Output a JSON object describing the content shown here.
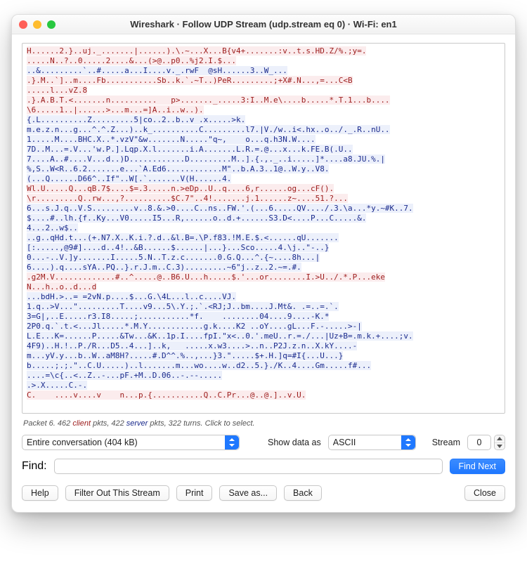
{
  "window": {
    "title": "Wireshark · Follow UDP Stream (udp.stream eq 0) · Wi-Fi: en1"
  },
  "stream": {
    "lines": [
      {
        "cls": "c",
        "t": "H......2.}..uj._.......|......).\\.~...X...B{v4+.......:v..t.s.HD.Z/%.;y=."
      },
      {
        "cls": "c",
        "t": ".....N..?..0.....2....&...(>@..p0..%j2.I.$..."
      },
      {
        "cls": "s",
        "t": "..&.........`..#.....a...I....v._.rwF  @sH......3..W_..."
      },
      {
        "cls": "c",
        "t": ".}.M..`]..m....Fb...........Sb..k.`.~T..)PeR.........;+X#.N...,=...C<B"
      },
      {
        "cls": "c",
        "t": ".....l...vZ.8"
      },
      {
        "cls": "c",
        "t": ".}.A.B.T.<.......n..........   p>......._.....3:I..M.e\\....b.....*.T.1...b...."
      },
      {
        "cls": "c",
        "t": "\\6.....1..|......>...m...=]A..i..w..)."
      },
      {
        "cls": "s",
        "t": "{.L..........Z.........5|co..2..b..v .x.....>k."
      },
      {
        "cls": "s",
        "t": "m.e.z.n...g...^.^.Z...)..k_..........C.........l7.|V./w..i<.hx..o../._.R..nU.."
      },
      {
        "cls": "s",
        "t": "1.....M....BHC.X..*.vzV\"&w.......N.....\"q~,    o...q.h3N.W...."
      },
      {
        "cls": "s",
        "t": "7D..M...=.V...'w.P.].Lqp.X.l.......i.A.......L.R.=.@...x...k.FE.B(.U.."
      },
      {
        "cls": "s",
        "t": "7....A..#....V...d..)D............D.........M..].{.,._..i.....]*....a8.JU.%.|"
      },
      {
        "cls": "s",
        "t": "%,S..W<R..6.2.......e...`A.Ed6............M\"..b.A.3..1@..W.y..V8."
      },
      {
        "cls": "s",
        "t": "(...Q......D66^..If\"..W[.`.......V(H......4."
      },
      {
        "cls": "c",
        "t": "Wl.U.....Q...qB.7$....$=.3.....n.>eDp..U..q....6,r......og...cF()."
      },
      {
        "cls": "c",
        "t": "\\r.........Q..rw...,?..........$C.7\"..4!.......j.1......z~....51.?..."
      },
      {
        "cls": "s",
        "t": "6...s.J.q..V.S.........v..8.&.>0....C..ns..FW.'.(...6.....QV..../.3.\\a...*y.~#K..7."
      },
      {
        "cls": "s",
        "t": "$....#..lh.{f..Ky...V0.....I5...R,......o..d.+......S3.D<....P...C.....&."
      },
      {
        "cls": "s",
        "t": "4...2..w$.."
      },
      {
        "cls": "s",
        "t": "..g..qHd.t...(+.N7.X..K.i.?.d..&l.B=.\\P.f83.!M.E.$.<......qU......."
      },
      {
        "cls": "s",
        "t": "[:.....,@9#]....d..4!..&B......$......|...}...Sco.....4.\\j..\"-..}"
      },
      {
        "cls": "s",
        "t": "0...-..V.]y.......I.....5.N..T.z.c.......0.G.Q...^.{~....8h...|"
      },
      {
        "cls": "s",
        "t": "6....).q....sYA..PQ..}.r.J.m..C.3).........~6\"j..z..2.~=.#."
      },
      {
        "cls": "c",
        "t": ".g2M.V.............#..^.....@..B6.U...h.....$.'...or........I.>U../.*.P...eke"
      },
      {
        "cls": "c",
        "t": "N...h..o..d...d"
      },
      {
        "cls": "s",
        "t": "...bdH.>..= =2vN.p....$...G.\\4L...l..c....VJ."
      },
      {
        "cls": "s",
        "t": "1.q..>V...\".........T....v9...5\\.Y.;.`.<RJ;J..bm....J.Mt&. .=..=.`."
      },
      {
        "cls": "s",
        "t": "3=G|,..E.....r3.I8.....;...........*f.    ........04....9....-K.*"
      },
      {
        "cls": "s",
        "t": "2P0.q.`.t.<...Jl.....*.M.Y............g.k....K2 ..oY....gL...F.-.....>-|"
      },
      {
        "cls": "s",
        "t": "L.E...K=......P.....&Tw...&K..1p.I....fpI.\"x<..0.'.meU..r.=./...|Uz+B=.m.k.+....;v."
      },
      {
        "cls": "s",
        "t": "4F9)..H.!..P./R...D5..4...]..k,   .....x.w3....>..n..P2J.z.n..X.kY....-"
      },
      {
        "cls": "s",
        "t": "m...yV.y...b..W..aM8H?.....#.D^^.%..,...}3.\".....$+.H.]q=#I{...U...}"
      },
      {
        "cls": "s",
        "t": "b.....;.;.\"..C.U.....)..l.......m...wo....w..d2..5.}./K..4....Gm.....f#..."
      },
      {
        "cls": "s",
        "t": "....=\\c{..<..Z..-...pF.+M..D.06..-.--....."
      },
      {
        "cls": "s",
        "t": ".>.X.....C.-."
      },
      {
        "cls": "c",
        "t": "C.    ....v....v    n...p.{...........Q..C.Pr...@..@.]..v.U."
      }
    ]
  },
  "status": {
    "prefix": "Packet 6. 462 ",
    "client_word": "client",
    "mid1": " pkts, 422 ",
    "server_word": "server",
    "suffix": " pkts, 322 turns. Click to select."
  },
  "controls": {
    "conversation_selected": "Entire conversation (404 kB)",
    "show_as_label": "Show data as",
    "show_as_selected": "ASCII",
    "stream_label": "Stream",
    "stream_value": "0",
    "find_label": "Find:",
    "find_value": "",
    "find_next": "Find Next"
  },
  "buttons": {
    "help": "Help",
    "filter_out": "Filter Out This Stream",
    "print": "Print",
    "save_as": "Save as...",
    "back": "Back",
    "close": "Close"
  }
}
